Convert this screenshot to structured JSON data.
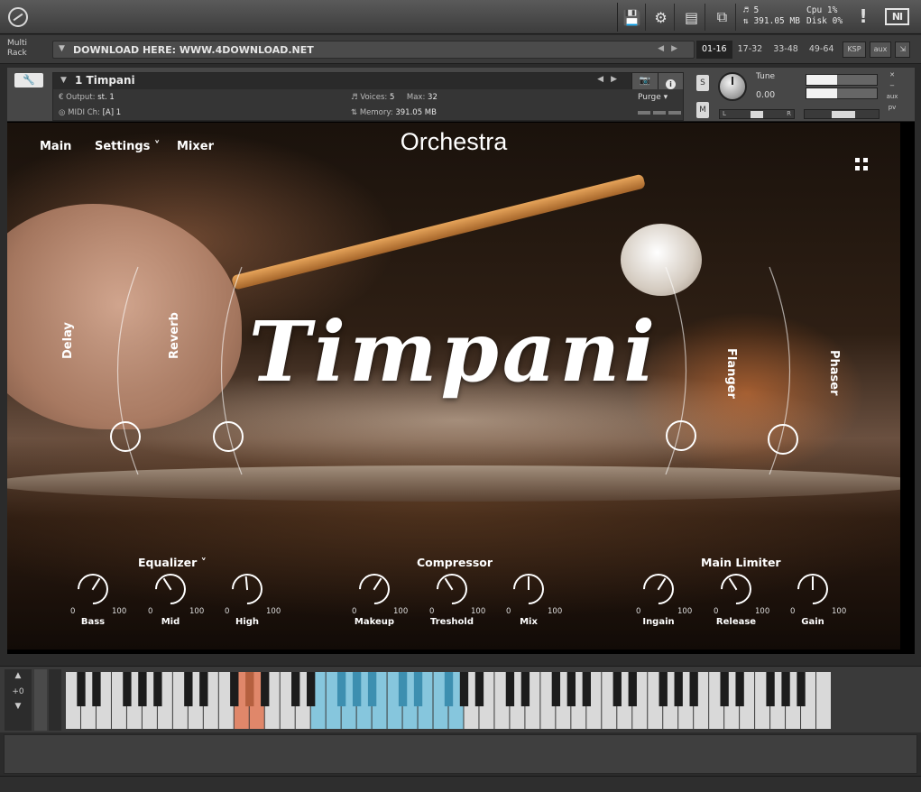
{
  "toolbar": {
    "stats": {
      "voices": "5",
      "memory": "391.05 MB",
      "cpu_label": "Cpu",
      "cpu_value": "1%",
      "disk_label": "Disk",
      "disk_value": "0%"
    },
    "ni_logo": "NI"
  },
  "rack": {
    "multirack_line1": "Multi",
    "multirack_line2": "Rack",
    "preset_name": "DOWNLOAD HERE: WWW.4DOWNLOAD.NET",
    "pages": [
      "01-16",
      "17-32",
      "33-48",
      "49-64"
    ],
    "active_page": "01-16",
    "ksp_label": "KSP",
    "aux_label": "aux"
  },
  "instrument": {
    "name": "1 Timpani",
    "output_label": "Output:",
    "output_value": "st. 1",
    "midi_label": "MIDI Ch:",
    "midi_value": "[A]  1",
    "voices_label": "Voices:",
    "voices_value": "5",
    "max_label": "Max:",
    "max_value": "32",
    "memory_label": "Memory:",
    "memory_value": "391.05 MB",
    "purge_label": "Purge",
    "solo_label": "S",
    "mute_label": "M",
    "tune_label": "Tune",
    "tune_value": "0.00",
    "pan_left": "L",
    "pan_right": "R",
    "aux_label": "aux",
    "pv_label": "pv"
  },
  "performance": {
    "nav": {
      "main": "Main",
      "settings": "Settings ˅",
      "mixer": "Mixer"
    },
    "header_title": "Orchestra",
    "instrument_title": "Timpani",
    "fx": [
      "Delay",
      "Reverb",
      "Flanger",
      "Phaser"
    ],
    "sections": {
      "equalizer": {
        "title": "Equalizer ˅",
        "knobs": [
          {
            "label": "Bass",
            "min": "0",
            "max": "100",
            "value": 0.62
          },
          {
            "label": "Mid",
            "min": "0",
            "max": "100",
            "value": 0.38
          },
          {
            "label": "High",
            "min": "0",
            "max": "100",
            "value": 0.48
          }
        ]
      },
      "compressor": {
        "title": "Compressor",
        "knobs": [
          {
            "label": "Makeup",
            "min": "0",
            "max": "100",
            "value": 0.62
          },
          {
            "label": "Treshold",
            "min": "0",
            "max": "100",
            "value": 0.38
          },
          {
            "label": "Mix",
            "min": "0",
            "max": "100",
            "value": 0.5
          }
        ]
      },
      "limiter": {
        "title": "Main Limiter",
        "knobs": [
          {
            "label": "Ingain",
            "min": "0",
            "max": "100",
            "value": 0.62
          },
          {
            "label": "Release",
            "min": "0",
            "max": "100",
            "value": 0.38
          },
          {
            "label": "Gain",
            "min": "0",
            "max": "100",
            "value": 0.5
          }
        ]
      }
    }
  },
  "keyboard": {
    "octave_shift": "+0",
    "highlight_colors": {
      "keyswitch": "#e0876a",
      "playable": "#86c6dd"
    }
  },
  "colors": {
    "accent": "#ffffff",
    "panel": "#474747",
    "background": "#2b2b2b"
  }
}
